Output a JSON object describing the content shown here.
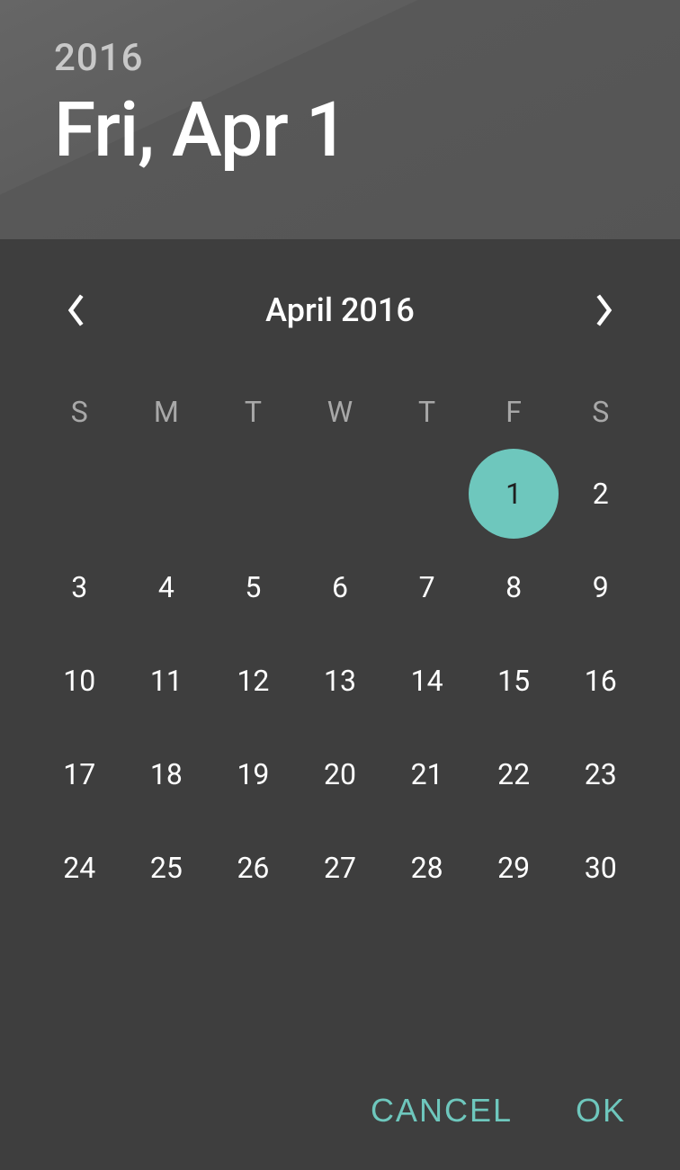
{
  "header": {
    "year": "2016",
    "date": "Fri, Apr 1"
  },
  "monthNav": {
    "label": "April 2016"
  },
  "weekdays": [
    "S",
    "M",
    "T",
    "W",
    "T",
    "F",
    "S"
  ],
  "calendar": {
    "leadingBlanks": 5,
    "daysInMonth": 30,
    "selectedDay": 1
  },
  "actions": {
    "cancel": "CANCEL",
    "ok": "OK"
  },
  "colors": {
    "accent": "#6ec7bd"
  }
}
